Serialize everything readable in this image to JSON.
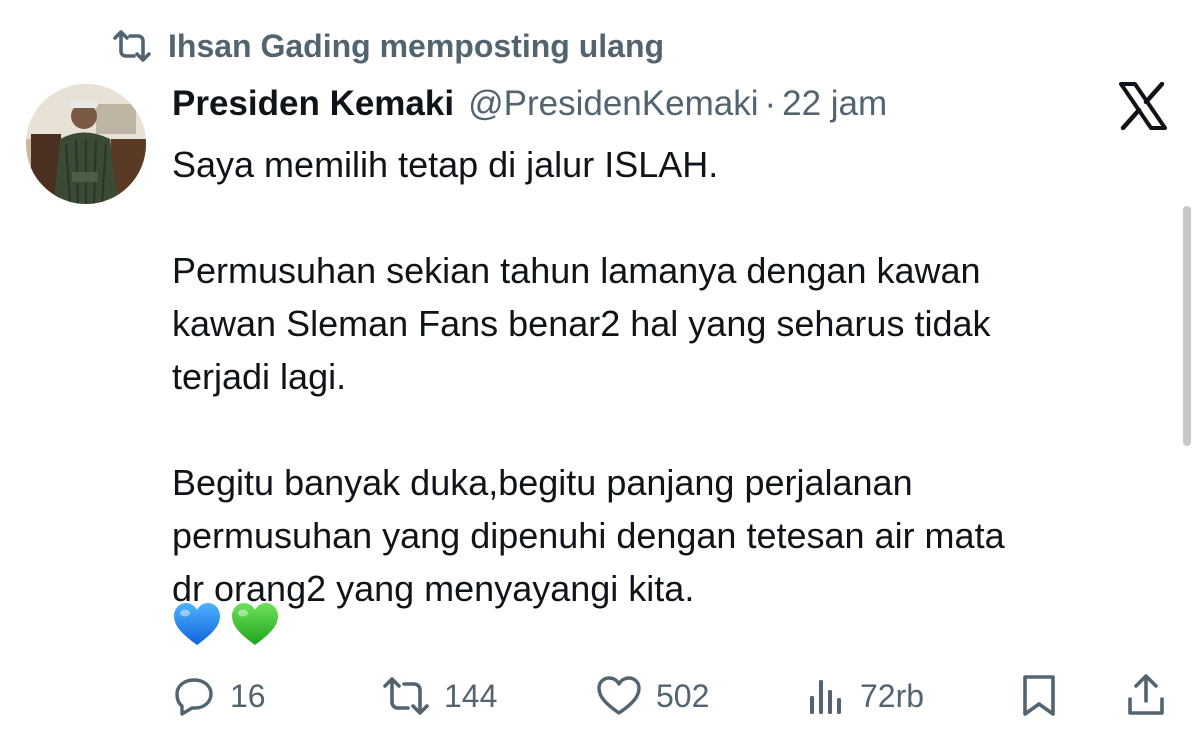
{
  "repost": {
    "label": "Ihsan Gading memposting ulang",
    "icon": "repost-icon"
  },
  "tweet": {
    "author_name": "Presiden Kemaki",
    "author_handle": "@PresidenKemaki",
    "separator": "·",
    "time": "22 jam",
    "paragraphs": [
      [
        "Saya memilih tetap di jalur ISLAH."
      ],
      [
        "Permusuhan sekian tahun lamanya dengan kawan",
        "kawan Sleman Fans benar2 hal yang seharus tidak",
        "terjadi lagi."
      ],
      [
        "Begitu banyak duka,begitu panjang perjalanan",
        "permusuhan yang dipenuhi dengan tetesan air mata",
        "dr orang2 yang menyayangi kita."
      ]
    ],
    "emojis": [
      "blue-heart",
      "green-heart"
    ]
  },
  "actions": {
    "replies": "16",
    "reposts": "144",
    "likes": "502",
    "views": "72rb"
  },
  "colors": {
    "text": "#0f1419",
    "muted": "#536471",
    "blue_heart": "#1d8cf8",
    "green_heart": "#3fc43a"
  },
  "icons": {
    "platform": "x-logo-icon",
    "reply": "reply-icon",
    "repost": "repost-icon",
    "like": "like-icon",
    "views": "views-icon",
    "bookmark": "bookmark-icon",
    "share": "share-icon"
  }
}
